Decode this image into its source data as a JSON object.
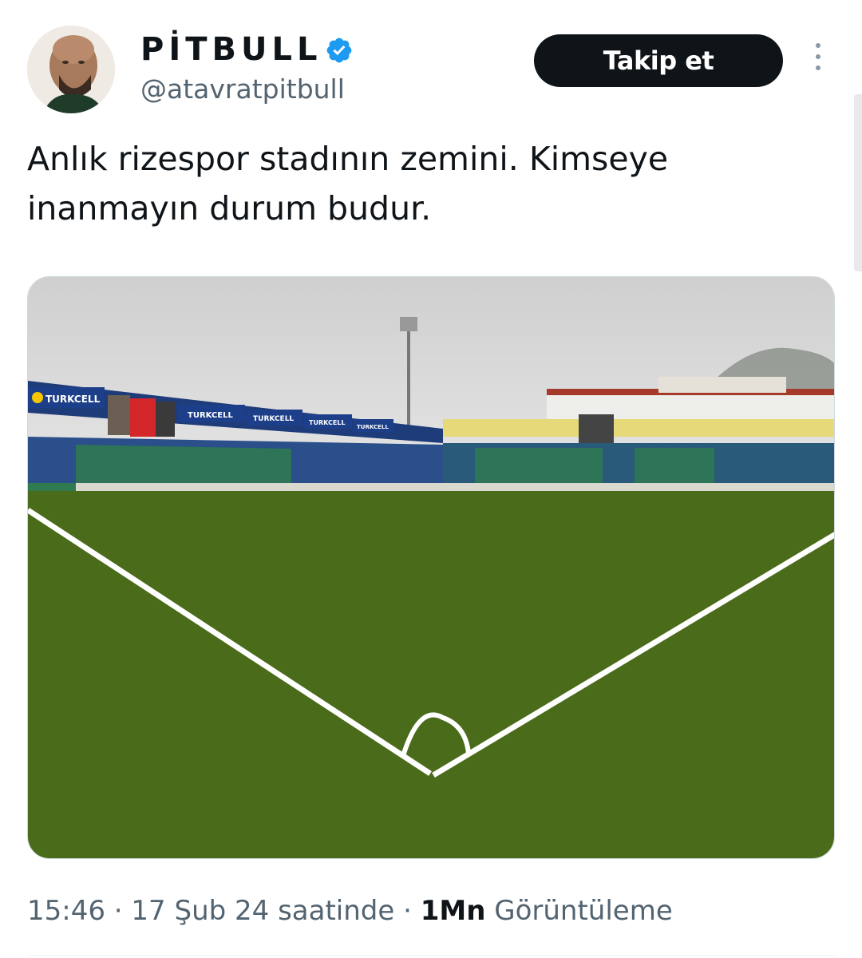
{
  "author": {
    "display_name": "PİTBULL",
    "handle": "@atavratpitbull",
    "verified": true,
    "verified_color": "#1d9bf0"
  },
  "actions": {
    "follow_label": "Takip et",
    "more_icon": "more-vertical-icon"
  },
  "tweet": {
    "text": "Anlık rizespor stadının zemini. Kimseye inanmayın durum budur.",
    "time": "15:46",
    "date": "17 Şub 24 saatinde",
    "separator": "·",
    "views_count": "1Mn",
    "views_label": "Görüntüleme"
  },
  "media": {
    "banners": [
      "TURKCELL",
      "TURKCELL",
      "TURKCELL",
      "TURKCELL",
      "TURKCELL"
    ],
    "pitch_color": "#4a6b1a",
    "sky_color": "#d8d8d8"
  },
  "colors": {
    "button_bg": "#0f1419",
    "secondary_text": "#536471"
  }
}
